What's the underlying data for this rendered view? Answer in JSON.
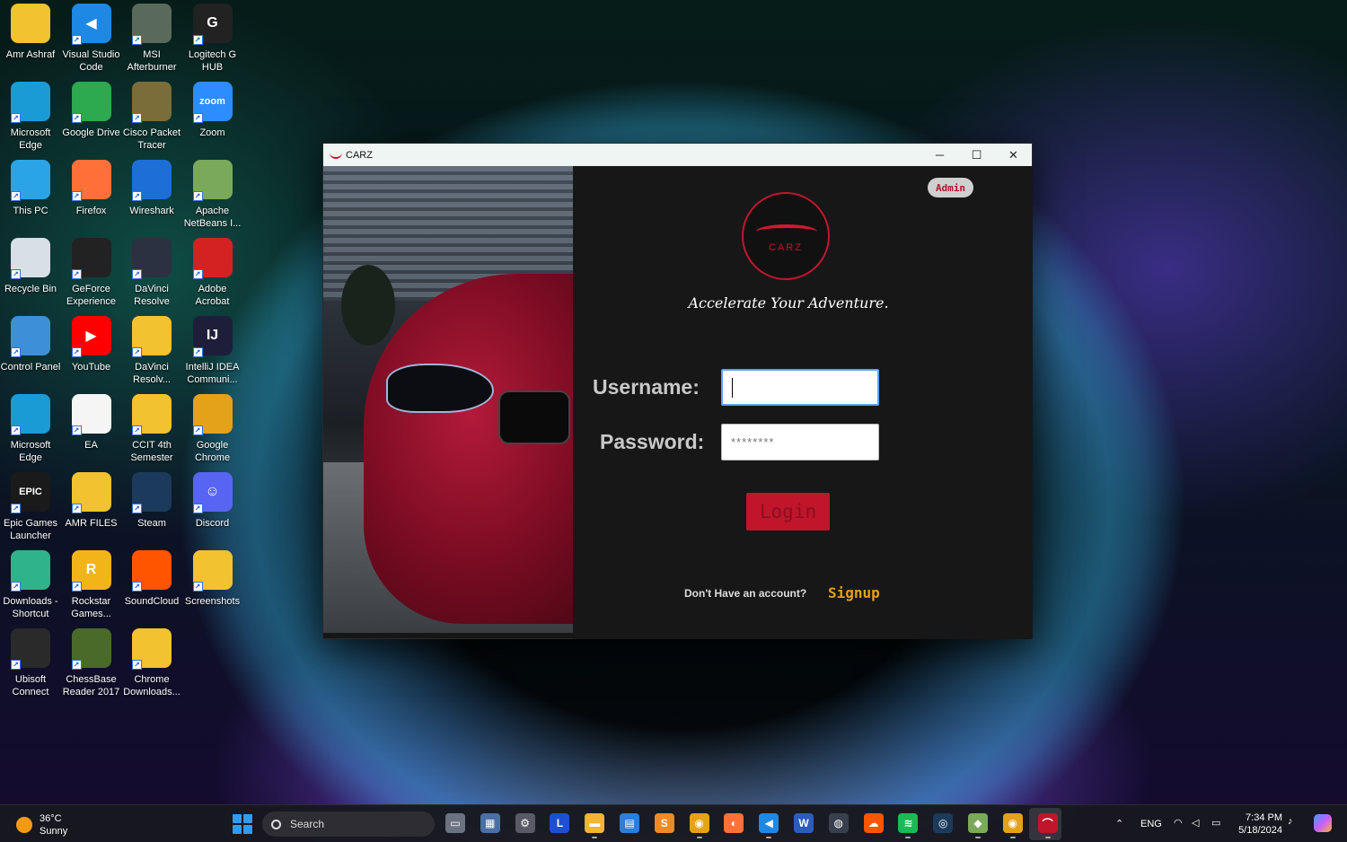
{
  "desktop": {
    "icons": [
      {
        "label": "Amr Ashraf",
        "icon": "user-folder-icon",
        "color": "#f2c231"
      },
      {
        "label": "Visual Studio Code",
        "icon": "vscode-icon",
        "color": "#1e88e5"
      },
      {
        "label": "MSI Afterburner",
        "icon": "msi-afterburner-icon",
        "color": "#5a6a5a"
      },
      {
        "label": "Logitech G HUB",
        "icon": "logitech-icon",
        "color": "#222"
      },
      {
        "label": "Microsoft Edge",
        "icon": "edge-icon",
        "color": "#1b9bd6"
      },
      {
        "label": "Google Drive",
        "icon": "google-drive-icon",
        "color": "#2da94f"
      },
      {
        "label": "Cisco Packet Tracer",
        "icon": "packet-tracer-icon",
        "color": "#7a6d3a"
      },
      {
        "label": "Zoom",
        "icon": "zoom-icon",
        "color": "#2d8cff"
      },
      {
        "label": "This PC",
        "icon": "monitor-icon",
        "color": "#2aa4e6"
      },
      {
        "label": "Firefox",
        "icon": "firefox-icon",
        "color": "#ff7139"
      },
      {
        "label": "Wireshark",
        "icon": "wireshark-icon",
        "color": "#1b6fd6"
      },
      {
        "label": "Apache NetBeans I...",
        "icon": "netbeans-icon",
        "color": "#7aa95a"
      },
      {
        "label": "Recycle Bin",
        "icon": "recycle-bin-icon",
        "color": "#d8dfe6"
      },
      {
        "label": "GeForce Experience",
        "icon": "nvidia-icon",
        "color": "#222"
      },
      {
        "label": "DaVinci Resolve",
        "icon": "davinci-icon",
        "color": "#2b3140"
      },
      {
        "label": "Adobe Acrobat",
        "icon": "acrobat-icon",
        "color": "#d42222"
      },
      {
        "label": "Control Panel",
        "icon": "control-panel-icon",
        "color": "#3d8fd6"
      },
      {
        "label": "YouTube",
        "icon": "youtube-icon",
        "color": "#ff0000"
      },
      {
        "label": "DaVinci Resolv...",
        "icon": "folder-icon",
        "color": "#f2c231"
      },
      {
        "label": "IntelliJ IDEA Communi...",
        "icon": "intellij-icon",
        "color": "#1e1e3a"
      },
      {
        "label": "Microsoft Edge",
        "icon": "edge-icon",
        "color": "#1b9bd6"
      },
      {
        "label": "EA",
        "icon": "document-icon",
        "color": "#f5f5f5"
      },
      {
        "label": "CCIT 4th Semester",
        "icon": "folder-icon",
        "color": "#f2c231"
      },
      {
        "label": "Google Chrome",
        "icon": "chrome-icon",
        "color": "#e3a21a"
      },
      {
        "label": "Epic Games Launcher",
        "icon": "epic-games-icon",
        "color": "#1a1a1a"
      },
      {
        "label": "AMR FILES",
        "icon": "folder-icon",
        "color": "#f2c231"
      },
      {
        "label": "Steam",
        "icon": "steam-icon",
        "color": "#1b3a5c"
      },
      {
        "label": "Discord",
        "icon": "discord-icon",
        "color": "#5865f2"
      },
      {
        "label": "Downloads - Shortcut",
        "icon": "downloads-folder-icon",
        "color": "#2fb38a"
      },
      {
        "label": "Rockstar Games...",
        "icon": "rockstar-icon",
        "color": "#f2b418"
      },
      {
        "label": "SoundCloud",
        "icon": "soundcloud-icon",
        "color": "#ff5500"
      },
      {
        "label": "Screenshots",
        "icon": "folder-icon",
        "color": "#f2c231"
      },
      {
        "label": "Ubisoft Connect",
        "icon": "ubisoft-icon",
        "color": "#2a2a2a"
      },
      {
        "label": "ChessBase Reader 2017",
        "icon": "chessbase-icon",
        "color": "#4a6a2a"
      },
      {
        "label": "Chrome Downloads...",
        "icon": "folder-icon",
        "color": "#f2c231"
      }
    ],
    "glyphs": {
      "vscode-icon": "◀",
      "zoom-icon": "zoom",
      "youtube-icon": "▶",
      "intellij-icon": "IJ",
      "epic-games-icon": "EPIC",
      "discord-icon": "☺",
      "rockstar-icon": "R",
      "logitech-icon": "G"
    }
  },
  "window": {
    "title": "CARZ",
    "controls": {
      "minimize": "─",
      "maximize": "☐",
      "close": "✕"
    },
    "admin_label": "Admin",
    "logo_text": "CARZ",
    "tagline": "Accelerate Your Adventure.",
    "username_label": "Username:",
    "username_value": "",
    "password_label": "Password:",
    "password_value": "********",
    "login_label": "Login",
    "no_account_text": "Don't Have an account?",
    "signup_label": "Signup",
    "colors": {
      "accent": "#c0152b",
      "link": "#e4a01b",
      "panel": "#171717"
    }
  },
  "taskbar": {
    "weather": {
      "temp": "36°C",
      "condition": "Sunny"
    },
    "search_placeholder": "Search",
    "apps": [
      {
        "name": "task-view-icon",
        "color": "#6b7280",
        "glyph": "▭"
      },
      {
        "name": "photos-icon",
        "color": "#4a6fa5",
        "glyph": "▦"
      },
      {
        "name": "settings-icon",
        "color": "#5a5a66",
        "glyph": "⚙"
      },
      {
        "name": "l-app-icon",
        "color": "#1f4fd1",
        "glyph": "L"
      },
      {
        "name": "file-explorer-icon",
        "color": "#f2b632",
        "glyph": "▬"
      },
      {
        "name": "microsoft-store-icon",
        "color": "#2d7fd6",
        "glyph": "▤"
      },
      {
        "name": "sublime-icon",
        "color": "#f08a24",
        "glyph": "S"
      },
      {
        "name": "chrome-icon",
        "color": "#e3a21a",
        "glyph": "◉"
      },
      {
        "name": "firefox-icon",
        "color": "#ff7139",
        "glyph": "◐"
      },
      {
        "name": "vscode-icon",
        "color": "#1e88e5",
        "glyph": "◀"
      },
      {
        "name": "word-icon",
        "color": "#2b5cb8",
        "glyph": "W"
      },
      {
        "name": "davinci-icon",
        "color": "#3a3f4d",
        "glyph": "◍"
      },
      {
        "name": "soundcloud-icon",
        "color": "#ff5500",
        "glyph": "☁"
      },
      {
        "name": "spotify-icon",
        "color": "#1db954",
        "glyph": "≋"
      },
      {
        "name": "steam-icon",
        "color": "#1b3a5c",
        "glyph": "◎"
      },
      {
        "name": "netbeans-icon",
        "color": "#7aa95a",
        "glyph": "◆"
      },
      {
        "name": "chrome-profile-icon",
        "color": "#e3a21a",
        "glyph": "◉"
      },
      {
        "name": "carz-app-icon",
        "color": "#c0152b",
        "glyph": "⌒"
      }
    ],
    "tray": {
      "language": "ENG",
      "time": "7:34 PM",
      "date": "5/18/2024"
    }
  }
}
